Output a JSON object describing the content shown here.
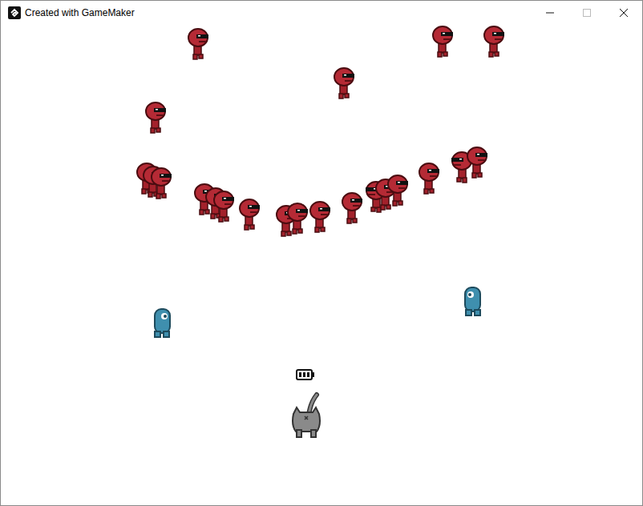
{
  "window": {
    "title": "Created with GameMaker"
  },
  "creatures": [
    {
      "kind": "red",
      "facing": "right"
    },
    {
      "kind": "red",
      "facing": "right"
    },
    {
      "kind": "red",
      "facing": "right"
    },
    {
      "kind": "red",
      "facing": "right"
    },
    {
      "kind": "red",
      "facing": "right"
    },
    {
      "kind": "red",
      "facing": "right"
    },
    {
      "kind": "red",
      "facing": "right"
    },
    {
      "kind": "red",
      "facing": "right"
    },
    {
      "kind": "red",
      "facing": "right"
    },
    {
      "kind": "red",
      "facing": "right"
    },
    {
      "kind": "red",
      "facing": "right"
    },
    {
      "kind": "red",
      "facing": "right"
    },
    {
      "kind": "red",
      "facing": "right"
    },
    {
      "kind": "red",
      "facing": "right"
    },
    {
      "kind": "red",
      "facing": "right"
    },
    {
      "kind": "red",
      "facing": "right"
    },
    {
      "kind": "red",
      "facing": "left"
    },
    {
      "kind": "red",
      "facing": "right"
    },
    {
      "kind": "red",
      "facing": "right"
    },
    {
      "kind": "red",
      "facing": "right"
    },
    {
      "kind": "red",
      "facing": "left"
    },
    {
      "kind": "red",
      "facing": "right"
    },
    {
      "kind": "blue",
      "facing": "right"
    },
    {
      "kind": "blue",
      "facing": "left"
    }
  ],
  "player": {
    "kind": "cat",
    "battery": {
      "level": 1.0
    }
  }
}
